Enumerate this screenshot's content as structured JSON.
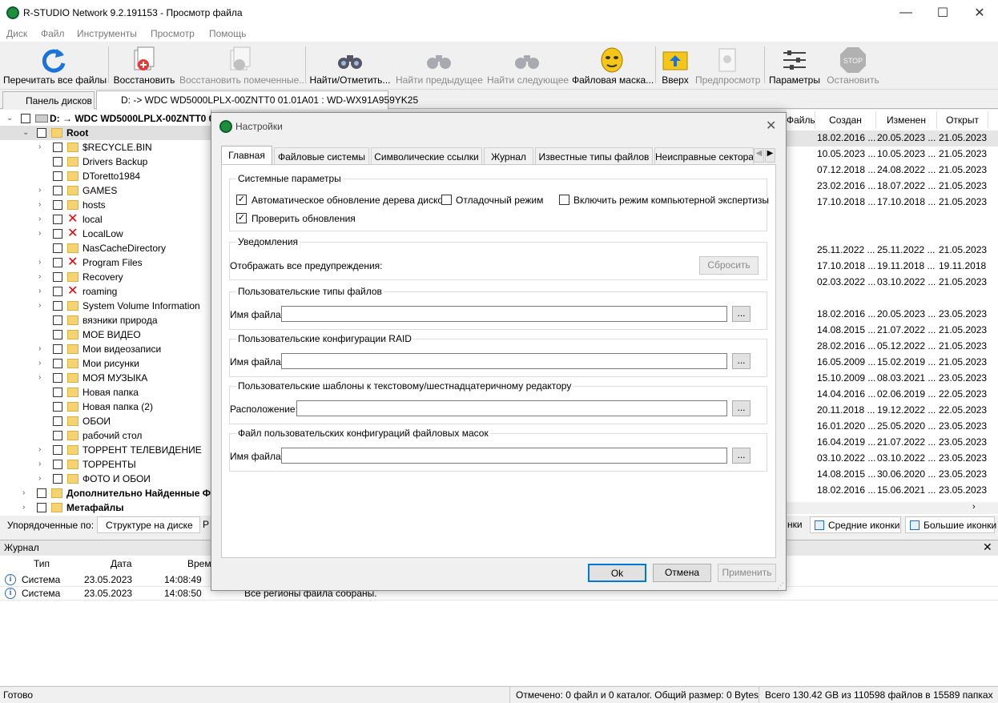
{
  "window": {
    "title": "R-STUDIO Network 9.2.191153 - Просмотр файла",
    "min": "—",
    "max": "☐",
    "close": "✕"
  },
  "menu": [
    "Диск",
    "Файл",
    "Инструменты",
    "Просмотр",
    "Помощь"
  ],
  "toolbar": {
    "rescan": "Перечитать все файлы",
    "recover": "Восстановить",
    "recover_marked": "Восстановить помеченные...",
    "find_mark": "Найти/Отметить...",
    "find_prev": "Найти предыдущее",
    "find_next": "Найти следующее",
    "file_mask": "Файловая маска...",
    "up": "Вверх",
    "preview": "Предпросмотр",
    "params": "Параметры",
    "stop": "Остановить",
    "stop_text": "STOP"
  },
  "tabs": {
    "drives": "Панель дисков",
    "file": "D: -> WDC WD5000LPLX-00ZNTT0 01.01A01 : WD-WX91A959YK25"
  },
  "tree": {
    "drive": "D: → WDC WD5000LPLX-00ZNTT0 0",
    "root": "Root",
    "items": [
      {
        "name": "$RECYCLE.BIN",
        "exp": "›",
        "del": false
      },
      {
        "name": "Drivers Backup",
        "exp": "",
        "del": false
      },
      {
        "name": "DToretto1984",
        "exp": "",
        "del": false
      },
      {
        "name": "GAMES",
        "exp": "›",
        "del": false
      },
      {
        "name": "hosts",
        "exp": "›",
        "del": false
      },
      {
        "name": "local",
        "exp": "›",
        "del": true
      },
      {
        "name": "LocalLow",
        "exp": "›",
        "del": true
      },
      {
        "name": "NasCacheDirectory",
        "exp": "",
        "del": false
      },
      {
        "name": "Program Files",
        "exp": "›",
        "del": true
      },
      {
        "name": "Recovery",
        "exp": "›",
        "del": false
      },
      {
        "name": "roaming",
        "exp": "›",
        "del": true
      },
      {
        "name": "System Volume Information",
        "exp": "›",
        "del": false
      },
      {
        "name": "вязники природа",
        "exp": "",
        "del": false
      },
      {
        "name": "МОЕ ВИДЕО",
        "exp": "",
        "del": false
      },
      {
        "name": "Мои видеозаписи",
        "exp": "›",
        "del": false
      },
      {
        "name": "Мои рисунки",
        "exp": "›",
        "del": false
      },
      {
        "name": "МОЯ МУЗЫКА",
        "exp": "›",
        "del": false
      },
      {
        "name": "Новая папка",
        "exp": "",
        "del": false
      },
      {
        "name": "Новая папка (2)",
        "exp": "",
        "del": false
      },
      {
        "name": "ОБОИ",
        "exp": "",
        "del": false
      },
      {
        "name": "рабочий стол",
        "exp": "",
        "del": false
      },
      {
        "name": "ТОРРЕНТ ТЕЛЕВИДЕНИЕ",
        "exp": "›",
        "del": false
      },
      {
        "name": "ТОРРЕНТЫ",
        "exp": "›",
        "del": false
      },
      {
        "name": "ФОТО И ОБОИ",
        "exp": "›",
        "del": false
      }
    ],
    "extra1": "Дополнительно Найденные Фа",
    "extra2": "Метафайлы"
  },
  "columns": {
    "files": "Файлы",
    "created": "Создан",
    "modified": "Изменен",
    "opened": "Открыт"
  },
  "rows": [
    {
      "c": "18.02.2016 ...",
      "m": "20.05.2023 ...",
      "o": "21.05.2023"
    },
    {
      "c": "10.05.2023 ...",
      "m": "10.05.2023 ...",
      "o": "21.05.2023"
    },
    {
      "c": "07.12.2018 ...",
      "m": "24.08.2022 ...",
      "o": "21.05.2023"
    },
    {
      "c": "23.02.2016 ...",
      "m": "18.07.2022 ...",
      "o": "21.05.2023"
    },
    {
      "c": "17.10.2018 ...",
      "m": "17.10.2018 ...",
      "o": "21.05.2023"
    },
    {
      "c": "",
      "m": "",
      "o": ""
    },
    {
      "c": "",
      "m": "",
      "o": ""
    },
    {
      "c": "25.11.2022 ...",
      "m": "25.11.2022 ...",
      "o": "21.05.2023"
    },
    {
      "c": "17.10.2018 ...",
      "m": "19.11.2018 ...",
      "o": "19.11.2018"
    },
    {
      "c": "02.03.2022 ...",
      "m": "03.10.2022 ...",
      "o": "21.05.2023"
    },
    {
      "c": "",
      "m": "",
      "o": ""
    },
    {
      "c": "18.02.2016 ...",
      "m": "20.05.2023 ...",
      "o": "23.05.2023"
    },
    {
      "c": "14.08.2015 ...",
      "m": "21.07.2022 ...",
      "o": "21.05.2023"
    },
    {
      "c": "28.02.2016 ...",
      "m": "05.12.2022 ...",
      "o": "21.05.2023"
    },
    {
      "c": "16.05.2009 ...",
      "m": "15.02.2019 ...",
      "o": "21.05.2023"
    },
    {
      "c": "15.10.2009 ...",
      "m": "08.03.2021 ...",
      "o": "23.05.2023"
    },
    {
      "c": "14.04.2016 ...",
      "m": "02.06.2019 ...",
      "o": "22.05.2023"
    },
    {
      "c": "20.11.2018 ...",
      "m": "19.12.2022 ...",
      "o": "22.05.2023"
    },
    {
      "c": "16.01.2020 ...",
      "m": "25.05.2020 ...",
      "o": "23.05.2023"
    },
    {
      "c": "16.04.2019 ...",
      "m": "21.07.2022 ...",
      "o": "23.05.2023"
    },
    {
      "c": "03.10.2022 ...",
      "m": "03.10.2022 ...",
      "o": "23.05.2023"
    },
    {
      "c": "14.08.2015 ...",
      "m": "30.06.2020 ...",
      "o": "23.05.2023"
    },
    {
      "c": "18.02.2016 ...",
      "m": "15.06.2021 ...",
      "o": "23.05.2023"
    }
  ],
  "sortbar": {
    "label": "Упорядоченные по:",
    "tab": "Структуре на диске",
    "tab2": "Р"
  },
  "viewbar": {
    "partial": "нки",
    "medium": "Средние иконки",
    "large": "Большие иконки"
  },
  "journal": {
    "title": "Журнал",
    "cols": {
      "type": "Тип",
      "date": "Дата",
      "time": "Время"
    },
    "rows": [
      {
        "type": "Система",
        "date": "23.05.2023",
        "time": "14:08:49",
        "msg": ""
      },
      {
        "type": "Система",
        "date": "23.05.2023",
        "time": "14:08:50",
        "msg": "Все регионы файла собраны."
      }
    ]
  },
  "status": {
    "ready": "Готово",
    "marked": "Отмечено: 0 файл и 0 каталог. Общий размер: 0 Bytes",
    "total": "Всего 130.42 GB из 110598 файлов в 15589 папках"
  },
  "dialog": {
    "title": "Настройки",
    "tabs": [
      "Главная",
      "Файловые системы",
      "Символические ссылки",
      "Журнал",
      "Известные типы файлов",
      "Неисправные сектора"
    ],
    "sys_group": "Системные параметры",
    "auto_update": "Автоматическое обновление дерева дисков",
    "debug": "Отладочный режим",
    "forensic": "Включить режим компьютерной экспертизы",
    "check_updates": "Проверить обновления",
    "notif_group": "Уведомления",
    "show_warnings": "Отображать все предупреждения:",
    "reset": "Сбросить",
    "user_types_group": "Пользовательские типы файлов",
    "file_name": "Имя файла:",
    "raid_group": "Пользовательские конфигурации RAID",
    "templates_group": "Пользовательские шаблоны к текстовому/шестнадцатеричному редактору",
    "location": "Расположение:",
    "masks_group": "Файл пользовательских конфигураций файловых масок",
    "browse": "...",
    "ok": "Ok",
    "cancel": "Отмена",
    "apply": "Применить",
    "auto_update_checked": true,
    "debug_checked": false,
    "forensic_checked": false,
    "check_updates_checked": true,
    "field1": "",
    "field2": "",
    "field3": "",
    "field4": ""
  }
}
